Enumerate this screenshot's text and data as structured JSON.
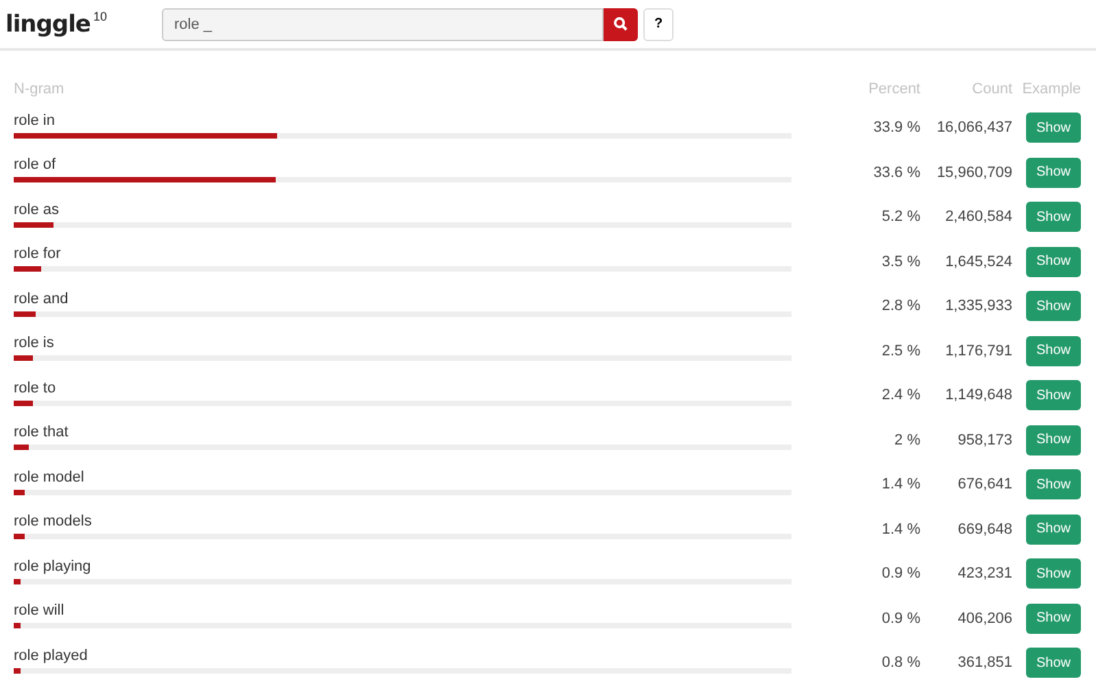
{
  "logo": {
    "name": "linggle",
    "version": "10"
  },
  "search": {
    "value": "role _"
  },
  "help_button": "?",
  "table": {
    "columns": [
      "N-gram",
      "Percent",
      "Count",
      "Example"
    ],
    "rows": [
      {
        "ngram": "role in",
        "level": 0.339,
        "percent": "33.9 %",
        "count": "16,066,437",
        "action": "Show"
      },
      {
        "ngram": "role of",
        "level": 0.336,
        "percent": "33.6 %",
        "count": "15,960,709",
        "action": "Show"
      },
      {
        "ngram": "role as",
        "level": 0.052,
        "percent": "5.2 %",
        "count": "2,460,584",
        "action": "Show"
      },
      {
        "ngram": "role for",
        "level": 0.035,
        "percent": "3.5 %",
        "count": "1,645,524",
        "action": "Show"
      },
      {
        "ngram": "role and",
        "level": 0.028,
        "percent": "2.8 %",
        "count": "1,335,933",
        "action": "Show"
      },
      {
        "ngram": "role is",
        "level": 0.025,
        "percent": "2.5 %",
        "count": "1,176,791",
        "action": "Show"
      },
      {
        "ngram": "role to",
        "level": 0.024,
        "percent": "2.4 %",
        "count": "1,149,648",
        "action": "Show"
      },
      {
        "ngram": "role that",
        "level": 0.02,
        "percent": "2 %",
        "count": "958,173",
        "action": "Show"
      },
      {
        "ngram": "role model",
        "level": 0.014,
        "percent": "1.4 %",
        "count": "676,641",
        "action": "Show"
      },
      {
        "ngram": "role models",
        "level": 0.014,
        "percent": "1.4 %",
        "count": "669,648",
        "action": "Show"
      },
      {
        "ngram": "role playing",
        "level": 0.009,
        "percent": "0.9 %",
        "count": "423,231",
        "action": "Show"
      },
      {
        "ngram": "role will",
        "level": 0.009,
        "percent": "0.9 %",
        "count": "406,206",
        "action": "Show"
      },
      {
        "ngram": "role played",
        "level": 0.008,
        "percent": "0.8 %",
        "count": "361,851",
        "action": "Show"
      }
    ]
  }
}
